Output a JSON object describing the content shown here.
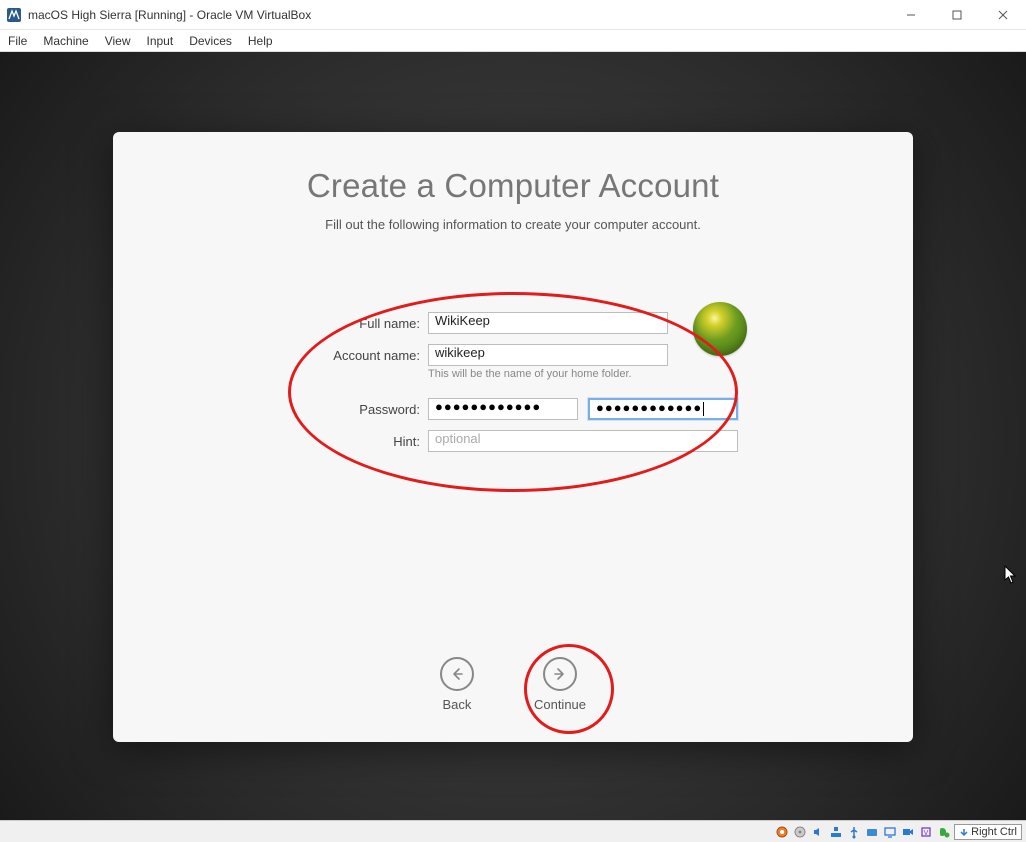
{
  "window": {
    "title": "macOS High Sierra [Running] - Oracle VM VirtualBox"
  },
  "menubar": {
    "file": "File",
    "machine": "Machine",
    "view": "View",
    "input": "Input",
    "devices": "Devices",
    "help": "Help"
  },
  "setup": {
    "title": "Create a Computer Account",
    "subtitle": "Fill out the following information to create your computer account.",
    "labels": {
      "fullname": "Full name:",
      "accountname": "Account name:",
      "password": "Password:",
      "hint": "Hint:"
    },
    "values": {
      "fullname": "WikiKeep",
      "accountname": "wikikeep",
      "password_mask": "●●●●●●●●●●●●",
      "password_confirm_mask": "●●●●●●●●●●●●",
      "hint": ""
    },
    "placeholders": {
      "hint": "optional"
    },
    "helper": {
      "accountname": "This will be the name of your home folder."
    },
    "nav": {
      "back": "Back",
      "continue": "Continue"
    }
  },
  "statusbar": {
    "host_key": "Right Ctrl"
  }
}
